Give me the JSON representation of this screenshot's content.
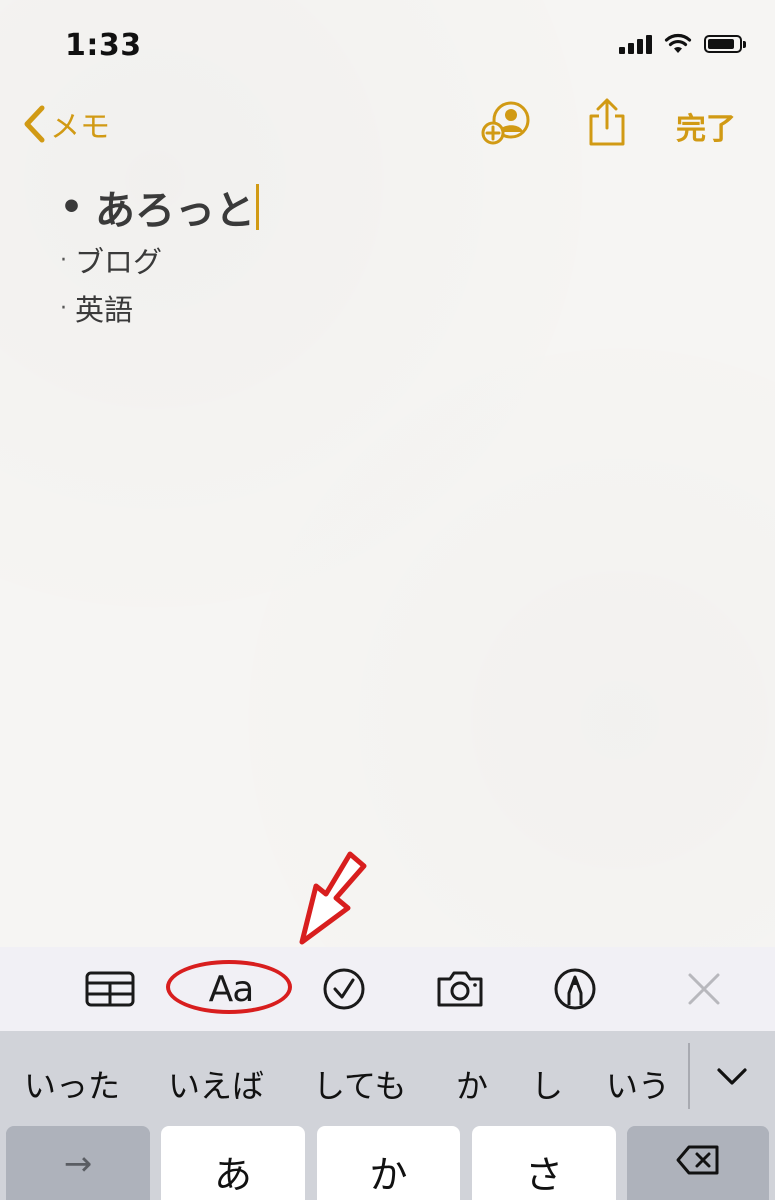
{
  "status_bar": {
    "time": "1:33",
    "icons": [
      "cellular-signal-icon",
      "wifi-icon",
      "battery-icon"
    ]
  },
  "nav": {
    "back_label": "メモ",
    "done_label": "完了",
    "icons": [
      "chevron-left-icon",
      "add-person-icon",
      "share-icon"
    ],
    "accent_color": "#d19a14"
  },
  "note": {
    "title": "あろっと",
    "items": [
      "ブログ",
      "英語"
    ],
    "bullet": "•",
    "item_bullet": "·"
  },
  "toolbar": {
    "table_icon": "table-icon",
    "format_label": "Aa",
    "checklist_icon": "checkmark-circle-icon",
    "camera_icon": "camera-icon",
    "markup_icon": "pen-circle-icon",
    "close_icon": "close-icon",
    "highlight_color": "#d81e1e"
  },
  "keyboard": {
    "predictions": [
      "いった",
      "いえば",
      "しても",
      "か",
      "し",
      "いう"
    ],
    "keys": {
      "arrow": "→",
      "a": "あ",
      "ka": "か",
      "sa": "さ"
    }
  }
}
